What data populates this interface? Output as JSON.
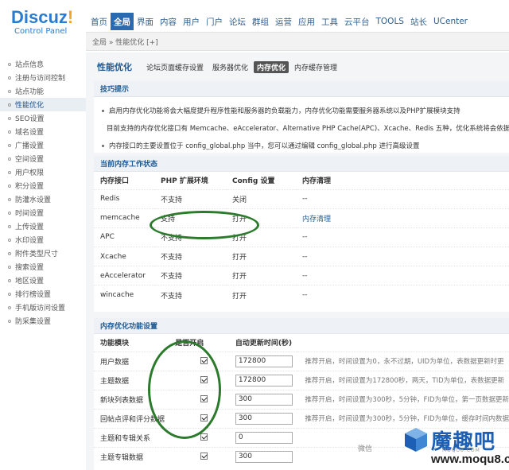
{
  "header": {
    "logo_main": "Discuz",
    "logo_bang": "!",
    "logo_sub": "Control Panel",
    "nav": [
      "首页",
      "全局",
      "界面",
      "内容",
      "用户",
      "门户",
      "论坛",
      "群组",
      "运营",
      "应用",
      "工具",
      "云平台",
      "TOOLS",
      "站长",
      "UCenter"
    ],
    "nav_active": 1,
    "breadcrumb": "全局 » 性能优化  [+]"
  },
  "sidebar": {
    "items": [
      "站点信息",
      "注册与访问控制",
      "站点功能",
      "性能优化",
      "SEO设置",
      "域名设置",
      "广播设置",
      "空间设置",
      "用户权限",
      "积分设置",
      "防灌水设置",
      "时间设置",
      "上传设置",
      "水印设置",
      "附件类型尺寸",
      "搜索设置",
      "地区设置",
      "排行榜设置",
      "手机版访问设置",
      "防采集设置"
    ],
    "active": 3
  },
  "main": {
    "title": "性能优化",
    "tabs": [
      "论坛页面缓存设置",
      "服务器优化",
      "内存优化",
      "内存缓存管理"
    ],
    "active_tab": 2,
    "tips_title": "技巧提示",
    "tips": [
      "启用内存优化功能将会大幅度提升程序性能和服务器的负载能力，内存优化功能需要服务器系统以及PHP扩展模块支持",
      "目前支持的内存优化接口有 Memcache、eAccelerator、Alternative PHP Cache(APC)、Xcache、Redis 五种，优化系统将会依据当前",
      "内存接口的主要设置位于 config_global.php 当中，您可以通过编辑 config_global.php 进行高级设置"
    ],
    "status_title": "当前内存工作状态",
    "status_headers": [
      "内存接口",
      "PHP 扩展环境",
      "Config 设置",
      "内存清理"
    ],
    "status_rows": [
      [
        "Redis",
        "不支持",
        "关闭",
        "--"
      ],
      [
        "memcache",
        "支持",
        "打开",
        "内存清理"
      ],
      [
        "APC",
        "不支持",
        "打开",
        "--"
      ],
      [
        "Xcache",
        "不支持",
        "打开",
        "--"
      ],
      [
        "eAccelerator",
        "不支持",
        "打开",
        "--"
      ],
      [
        "wincache",
        "不支持",
        "打开",
        "--"
      ]
    ],
    "opt_title": "内存优化功能设置",
    "opt_headers": [
      "功能模块",
      "是否开启",
      "自动更新时间(秒)"
    ],
    "opt_rows": [
      {
        "name": "用户数据",
        "value": "172800",
        "hint": "推荐开启，时间设置为0，永不过期，UID为单位，表数据更新时更"
      },
      {
        "name": "主题数据",
        "value": "172800",
        "hint": "推荐开启，时间设置为172800秒，两天，TID为单位，表数据更新"
      },
      {
        "name": "新块列表数据",
        "value": "300",
        "hint": "推荐开启，时间设置为300秒，5分钟，FID为单位，第一页数据更新"
      },
      {
        "name": "回帖点评和评分数据",
        "value": "300",
        "hint": "推荐开启，时间设置为300秒，5分钟，FID为单位，缓存时间内数据"
      },
      {
        "name": "主题和专辑关系",
        "value": "0",
        "hint": ""
      },
      {
        "name": "主题专辑数据",
        "value": "300",
        "hint": ""
      }
    ]
  },
  "watermark": {
    "brand": "魔趣吧",
    "domain": "www.moqu8.com",
    "small": "MOQU8.COM",
    "wechat": "微信"
  }
}
